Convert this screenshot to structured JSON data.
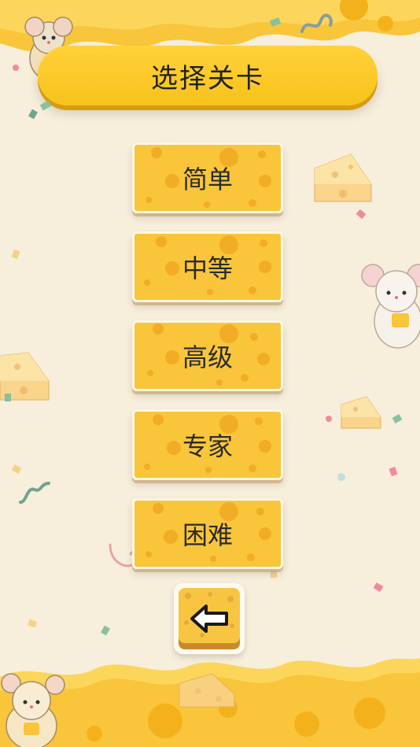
{
  "screen": {
    "title": "选择关卡"
  },
  "levels": [
    {
      "label": "简单"
    },
    {
      "label": "中等"
    },
    {
      "label": "高级"
    },
    {
      "label": "专家"
    },
    {
      "label": "困难"
    }
  ],
  "back_button": {
    "icon": "arrow-left-icon"
  },
  "colors": {
    "background": "#f7eedb",
    "cheese": "#f9c53a",
    "banner": "#f7c21a",
    "text": "#222222"
  }
}
